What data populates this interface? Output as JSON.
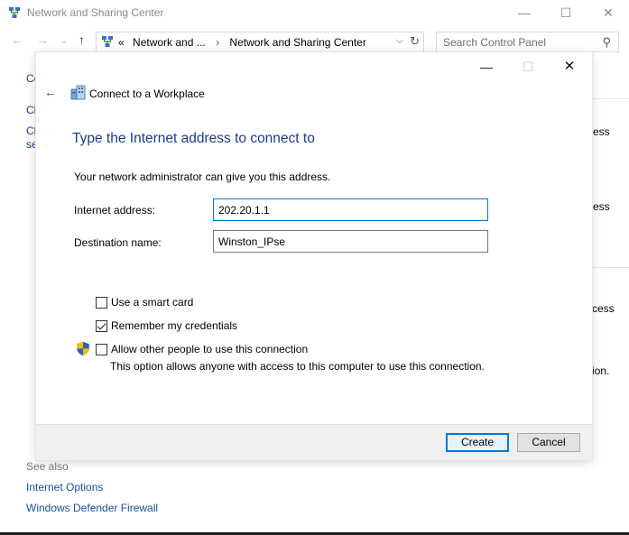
{
  "background_window": {
    "title": "Network and Sharing Center",
    "controls": {
      "minimize": "—",
      "maximize": "☐",
      "close": "✕"
    },
    "nav": {
      "back": "←",
      "forward": "→",
      "recent": "⌄",
      "up": "↑"
    },
    "breadcrumb": {
      "root": "«",
      "items": [
        "Network and ...",
        "Network and Sharing Center"
      ],
      "separator": "›"
    },
    "search": {
      "placeholder": "Search Control Panel"
    },
    "left_links": [
      "Co",
      "Ch",
      "Ch",
      "se"
    ],
    "right_fragments": [
      "ess",
      "ess",
      "cess",
      "ion."
    ],
    "see_also": {
      "title": "See also",
      "links": [
        "Internet Options",
        "Windows Defender Firewall"
      ]
    }
  },
  "dialog": {
    "controls": {
      "minimize": "—",
      "maximize": "☐",
      "close": "✕"
    },
    "back": "←",
    "heading": "Connect to a Workplace",
    "title": "Type the Internet address to connect to",
    "description": "Your network administrator can give you this address.",
    "fields": {
      "internet_address": {
        "label": "Internet address:",
        "value": "202.20.1.1"
      },
      "destination_name": {
        "label": "Destination name:",
        "value": "Winston_IPse"
      }
    },
    "options": {
      "smart_card": {
        "label": "Use a smart card",
        "checked": false
      },
      "remember_credentials": {
        "label": "Remember my credentials",
        "checked": true
      },
      "allow_others": {
        "label": "Allow other people to use this connection",
        "checked": false,
        "help": "This option allows anyone with access to this computer to use this connection."
      }
    },
    "buttons": {
      "create": "Create",
      "cancel": "Cancel"
    }
  },
  "colors": {
    "accent": "#0078d7",
    "title_blue": "#1a3c8f",
    "link_blue": "#1a3f8c"
  },
  "icons": [
    "network-icon",
    "vpn-workplace-icon",
    "shield-icon",
    "search-icon",
    "refresh-icon",
    "back-arrow-icon",
    "checkmark-icon"
  ]
}
